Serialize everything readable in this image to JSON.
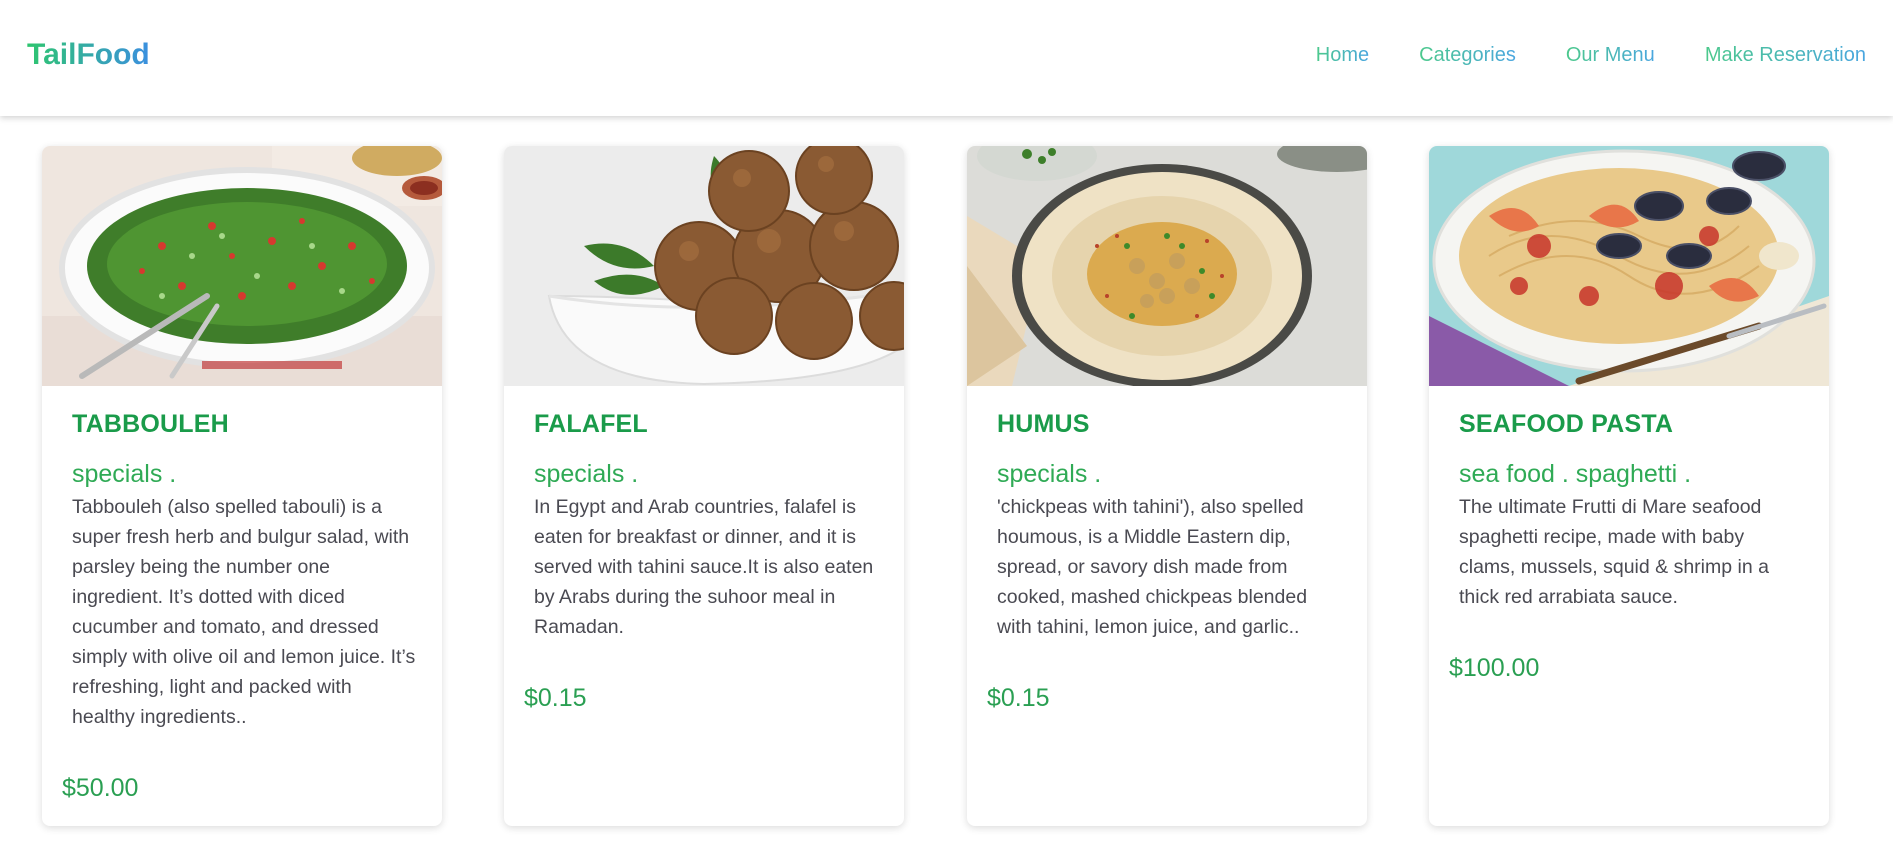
{
  "navbar": {
    "logo": "TailFood",
    "links": [
      {
        "label": "Home"
      },
      {
        "label": "Categories"
      },
      {
        "label": "Our Menu"
      },
      {
        "label": "Make Reservation"
      }
    ]
  },
  "cards": [
    {
      "title": "TABBOULEH",
      "tags": "specials .",
      "description": "Tabbouleh (also spelled tabouli) is a super fresh herb and bulgur salad, with parsley being the number one ingredient. It’s dotted with diced cucumber and tomato, and dressed simply with olive oil and lemon juice. It’s refreshing, light and packed with healthy ingredients..",
      "price": "$50.00",
      "image": "tabbouleh-photo"
    },
    {
      "title": "FALAFEL",
      "tags": "specials .",
      "description": "In Egypt and Arab countries, falafel is eaten for breakfast or dinner, and it is served with tahini sauce.It is also eaten by Arabs during the suhoor meal in Ramadan.",
      "price": "$0.15",
      "image": "falafel-photo"
    },
    {
      "title": "HUMUS",
      "tags": "specials .",
      "description": "'chickpeas with tahini'), also spelled houmous, is a Middle Eastern dip, spread, or savory dish made from cooked, mashed chickpeas blended with tahini, lemon juice, and garlic..",
      "price": "$0.15",
      "image": "humus-photo"
    },
    {
      "title": "SEAFOOD PASTA",
      "tags": "sea food . spaghetti .",
      "description": "The ultimate Frutti di Mare seafood spaghetti recipe, made with baby clams, mussels, squid & shrimp in a thick red arrabiata sauce.",
      "price": "$100.00",
      "image": "seafood-pasta-photo"
    }
  ],
  "colors": {
    "title_green": "#1a9b4a",
    "price_green": "#2a9f52",
    "logo_gradient_start": "#2ec56f",
    "logo_gradient_end": "#3b8fe0"
  }
}
